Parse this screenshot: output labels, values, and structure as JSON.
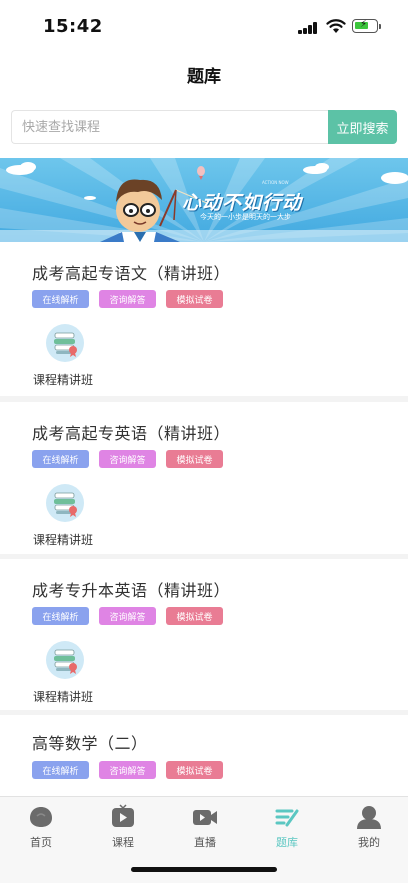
{
  "status_bar": {
    "time": "15:42"
  },
  "header": {
    "title": "题库"
  },
  "search": {
    "placeholder": "快速查找课程",
    "button_label": "立即搜索"
  },
  "banner": {
    "headline": "心动不如行动",
    "subline": "今天的一小步是明天的一大步",
    "tiny_text": "ACTION NOW"
  },
  "cards": [
    {
      "title": "成考高起专语文（精讲班）",
      "tags": [
        "在线解析",
        "咨询解答",
        "模拟试卷"
      ],
      "course_label": "课程精讲班"
    },
    {
      "title": "成考高起专英语（精讲班）",
      "tags": [
        "在线解析",
        "咨询解答",
        "模拟试卷"
      ],
      "course_label": "课程精讲班"
    },
    {
      "title": "成考专升本英语（精讲班）",
      "tags": [
        "在线解析",
        "咨询解答",
        "模拟试卷"
      ],
      "course_label": "课程精讲班"
    },
    {
      "title": "高等数学（二）",
      "tags": [
        "在线解析",
        "咨询解答",
        "模拟试卷"
      ]
    }
  ],
  "tab_bar": {
    "items": [
      {
        "label": "首页",
        "icon": "home-icon"
      },
      {
        "label": "课程",
        "icon": "course-play-icon"
      },
      {
        "label": "直播",
        "icon": "live-camera-icon"
      },
      {
        "label": "题库",
        "icon": "question-bank-icon"
      },
      {
        "label": "我的",
        "icon": "profile-icon"
      }
    ],
    "active_index": 3
  },
  "colors": {
    "accent": "#5cc2a6",
    "tab_active": "#5bc7c2",
    "tag_analysis": "#8aa2ee",
    "tag_consult": "#df84e4",
    "tag_exam": "#e97c94",
    "banner_sky": "#42a9e0"
  }
}
